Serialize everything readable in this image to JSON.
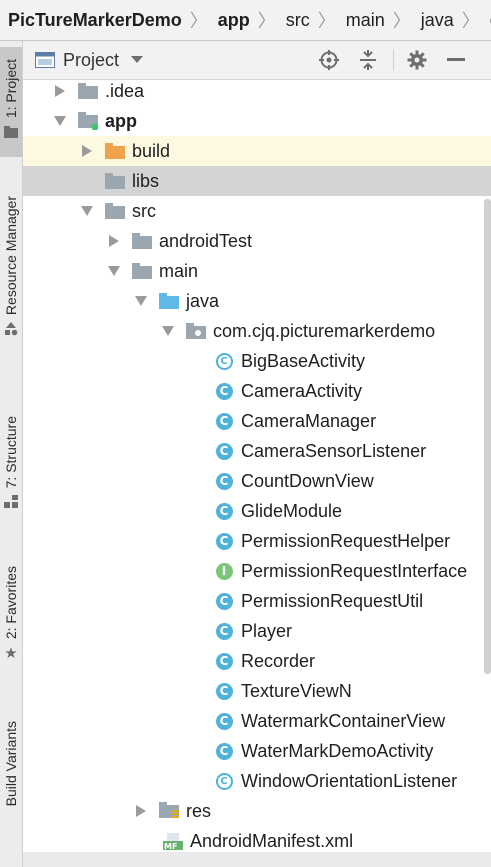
{
  "breadcrumb": [
    "PicTureMarkerDemo",
    "app",
    "src",
    "main",
    "java",
    "com"
  ],
  "panel": {
    "title": "Project"
  },
  "tool_strip": {
    "tab1": "1: Project",
    "tab2": "Resource Manager",
    "tab3": "7: Structure",
    "tab4": "2: Favorites",
    "tab5": "Build Variants"
  },
  "tree": [
    {
      "label": ".idea"
    },
    {
      "label": "app"
    },
    {
      "label": "build"
    },
    {
      "label": "libs"
    },
    {
      "label": "src"
    },
    {
      "label": "androidTest"
    },
    {
      "label": "main"
    },
    {
      "label": "java"
    },
    {
      "label": "com.cjq.picturemarkerdemo"
    },
    {
      "label": "BigBaseActivity"
    },
    {
      "label": "CameraActivity"
    },
    {
      "label": "CameraManager"
    },
    {
      "label": "CameraSensorListener"
    },
    {
      "label": "CountDownView"
    },
    {
      "label": "GlideModule"
    },
    {
      "label": "PermissionRequestHelper"
    },
    {
      "label": "PermissionRequestInterface"
    },
    {
      "label": "PermissionRequestUtil"
    },
    {
      "label": "Player"
    },
    {
      "label": "Recorder"
    },
    {
      "label": "TextureViewN"
    },
    {
      "label": "WatermarkContainerView"
    },
    {
      "label": "WaterMarkDemoActivity"
    },
    {
      "label": "WindowOrientationListener"
    },
    {
      "label": "res"
    },
    {
      "label": "AndroidManifest.xml"
    }
  ],
  "colors": {
    "class_icon": "#4fb3d9",
    "interface_icon": "#7cc47a",
    "folder": "#9aa7b0",
    "build_folder": "#f0a34a",
    "source_folder": "#5eb9e8"
  }
}
